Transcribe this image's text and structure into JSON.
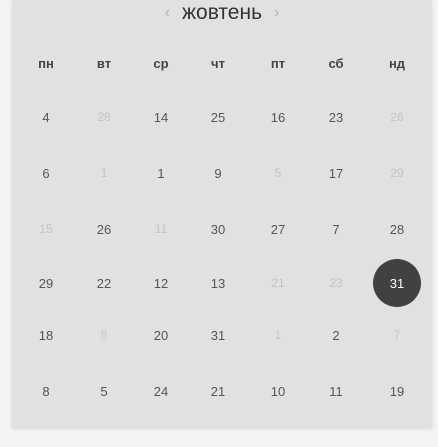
{
  "header": {
    "prev_symbol": "‹",
    "month": "жовтень",
    "next_symbol": "›"
  },
  "weekdays": [
    "пн",
    "вт",
    "ср",
    "чт",
    "пт",
    "сб",
    "нд"
  ],
  "weeks": [
    [
      {
        "text": "4",
        "muted": false
      },
      {
        "text": "28",
        "muted": true
      },
      {
        "text": "14",
        "muted": false
      },
      {
        "text": "25",
        "muted": false
      },
      {
        "text": "16",
        "muted": false
      },
      {
        "text": "23",
        "muted": false
      },
      {
        "text": "26",
        "muted": true
      }
    ],
    [
      {
        "text": "6",
        "muted": false
      },
      {
        "text": "1",
        "muted": true
      },
      {
        "text": "1",
        "muted": false
      },
      {
        "text": "9",
        "muted": false
      },
      {
        "text": "5",
        "muted": true
      },
      {
        "text": "17",
        "muted": false
      },
      {
        "text": "29",
        "muted": true
      }
    ],
    [
      {
        "text": "15",
        "muted": true
      },
      {
        "text": "26",
        "muted": false
      },
      {
        "text": "11",
        "muted": true
      },
      {
        "text": "30",
        "muted": false
      },
      {
        "text": "27",
        "muted": false
      },
      {
        "text": "7",
        "muted": false
      },
      {
        "text": "28",
        "muted": false
      }
    ],
    [
      {
        "text": "29",
        "muted": false
      },
      {
        "text": "22",
        "muted": false
      },
      {
        "text": "12",
        "muted": false
      },
      {
        "text": "13",
        "muted": false
      },
      {
        "text": "21",
        "muted": true
      },
      {
        "text": "23",
        "muted": true
      },
      {
        "text": "31",
        "muted": false,
        "selected": true
      }
    ],
    [
      {
        "text": "18",
        "muted": false
      },
      {
        "text": "8",
        "muted": true
      },
      {
        "text": "20",
        "muted": false
      },
      {
        "text": "31",
        "muted": false
      },
      {
        "text": "1",
        "muted": true
      },
      {
        "text": "2",
        "muted": false
      },
      {
        "text": "7",
        "muted": true
      }
    ],
    [
      {
        "text": "8",
        "muted": false
      },
      {
        "text": "5",
        "muted": false
      },
      {
        "text": "24",
        "muted": false
      },
      {
        "text": "21",
        "muted": false
      },
      {
        "text": "10",
        "muted": false
      },
      {
        "text": "11",
        "muted": false
      },
      {
        "text": "19",
        "muted": false
      }
    ]
  ],
  "colors": {
    "background": "#e1e1e1",
    "selected": "#414141",
    "muted_text": "#c2c2c2"
  }
}
